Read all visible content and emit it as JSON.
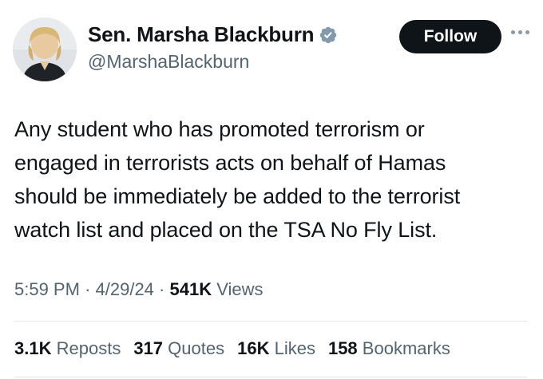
{
  "author": {
    "name": "Sen. Marsha Blackburn",
    "handle": "@MarshaBlackburn",
    "verified_icon": "verified-badge-icon",
    "verified_color": "#829aab"
  },
  "follow_label": "Follow",
  "tweet_lines": [
    "Any student who has promoted terrorism or",
    "engaged in terrorists acts on behalf of Hamas",
    "should be immediately be added to the terrorist",
    "watch list and placed on the TSA No Fly List."
  ],
  "meta": {
    "time": "5:59 PM",
    "sep": "·",
    "date": "4/29/24",
    "views_count": "541K",
    "views_label": "Views"
  },
  "stats": [
    {
      "count": "3.1K",
      "label": "Reposts"
    },
    {
      "count": "317",
      "label": "Quotes"
    },
    {
      "count": "16K",
      "label": "Likes"
    },
    {
      "count": "158",
      "label": "Bookmarks"
    }
  ]
}
